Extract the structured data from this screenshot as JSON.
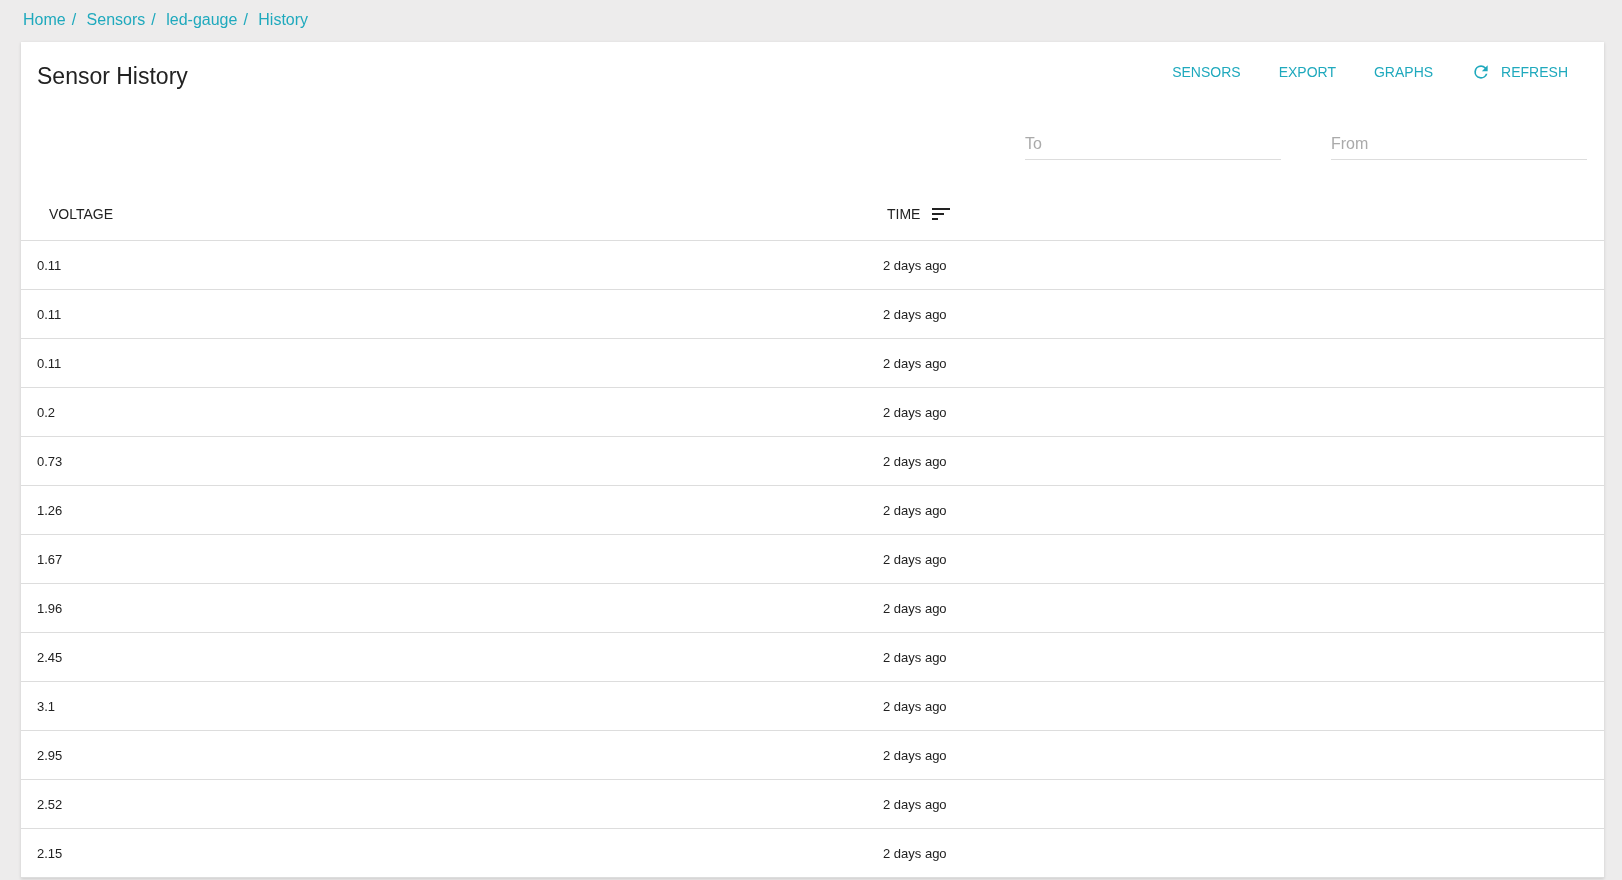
{
  "breadcrumb": {
    "separator": "/",
    "items": [
      "Home",
      "Sensors",
      "led-gauge",
      "History"
    ]
  },
  "title": "Sensor History",
  "actions": [
    {
      "label": "SENSORS",
      "kind": "text"
    },
    {
      "label": "EXPORT",
      "kind": "text"
    },
    {
      "label": "GRAPHS",
      "kind": "text"
    },
    {
      "label": "REFRESH",
      "kind": "refresh"
    }
  ],
  "filters": [
    {
      "placeholder": "To"
    },
    {
      "placeholder": "From"
    }
  ],
  "table": {
    "columns": [
      {
        "label": "VOLTAGE",
        "sorted": false
      },
      {
        "label": "TIME",
        "sorted": true
      }
    ],
    "rows": [
      [
        "0.11",
        "2 days ago"
      ],
      [
        "0.11",
        "2 days ago"
      ],
      [
        "0.11",
        "2 days ago"
      ],
      [
        "0.2",
        "2 days ago"
      ],
      [
        "0.73",
        "2 days ago"
      ],
      [
        "1.26",
        "2 days ago"
      ],
      [
        "1.67",
        "2 days ago"
      ],
      [
        "1.96",
        "2 days ago"
      ],
      [
        "2.45",
        "2 days ago"
      ],
      [
        "3.1",
        "2 days ago"
      ],
      [
        "2.95",
        "2 days ago"
      ],
      [
        "2.52",
        "2 days ago"
      ],
      [
        "2.15",
        "2 days ago"
      ]
    ]
  }
}
